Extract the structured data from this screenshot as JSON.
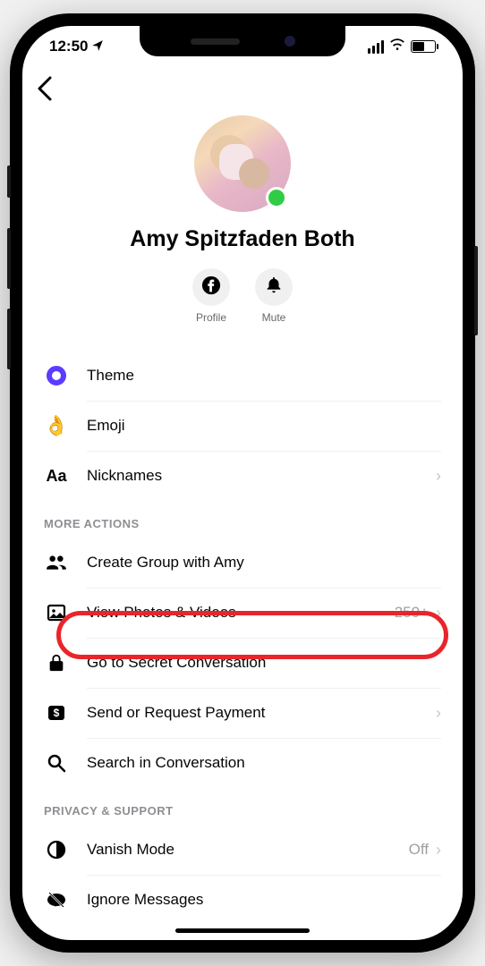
{
  "status": {
    "time": "12:50",
    "location_indicator": "➤"
  },
  "profile": {
    "name": "Amy Spitzfaden Both",
    "actions": {
      "profile": "Profile",
      "mute": "Mute"
    }
  },
  "settings": {
    "theme": "Theme",
    "emoji": "Emoji",
    "nicknames": "Nicknames"
  },
  "sections": {
    "more_actions": "MORE ACTIONS",
    "privacy_support": "PRIVACY & SUPPORT"
  },
  "more_actions": {
    "create_group": "Create Group with Amy",
    "view_photos": "View Photos & Videos",
    "view_photos_count": "250+",
    "secret_conversation": "Go to Secret Conversation",
    "payment": "Send or Request Payment",
    "search": "Search in Conversation"
  },
  "privacy": {
    "vanish_mode": "Vanish Mode",
    "vanish_status": "Off",
    "ignore": "Ignore Messages"
  }
}
